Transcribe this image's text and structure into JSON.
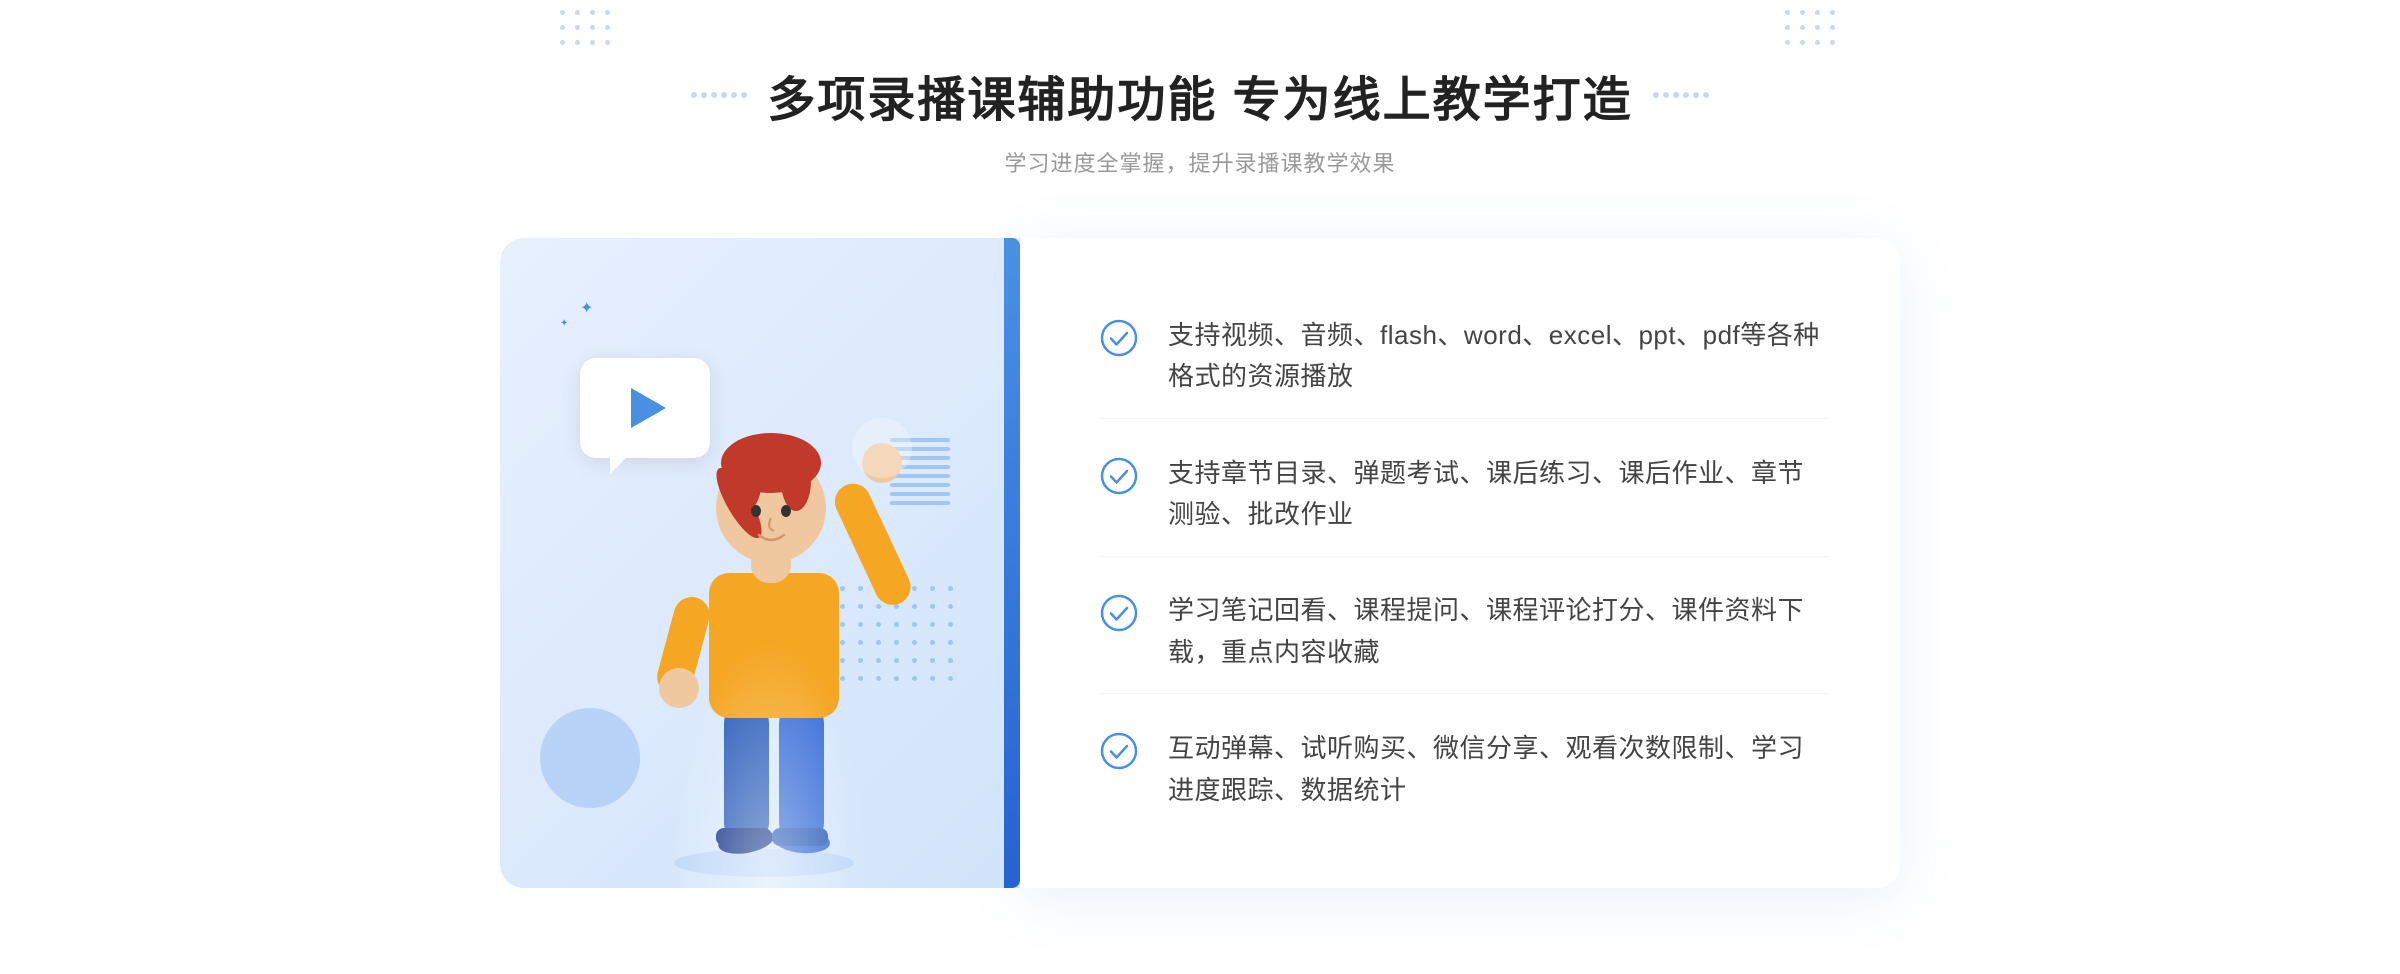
{
  "header": {
    "title": "多项录播课辅助功能 专为线上教学打造",
    "subtitle": "学习进度全掌握，提升录播课教学效果",
    "dots_left_label": "decorative dots left",
    "dots_right_label": "decorative dots right"
  },
  "features": [
    {
      "id": 1,
      "text": "支持视频、音频、flash、word、excel、ppt、pdf等各种格式的资源播放"
    },
    {
      "id": 2,
      "text": "支持章节目录、弹题考试、课后练习、课后作业、章节测验、批改作业"
    },
    {
      "id": 3,
      "text": "学习笔记回看、课程提问、课程评论打分、课件资料下载，重点内容收藏"
    },
    {
      "id": 4,
      "text": "互动弹幕、试听购买、微信分享、观看次数限制、学习进度跟踪、数据统计"
    }
  ],
  "colors": {
    "primary": "#4a90e2",
    "primary_dark": "#2563d0",
    "text_main": "#222222",
    "text_sub": "#999999",
    "text_feature": "#444444",
    "bg_illustration": "#deeaf9",
    "check_color": "#4a90e2",
    "border_light": "#f0f5ff"
  }
}
